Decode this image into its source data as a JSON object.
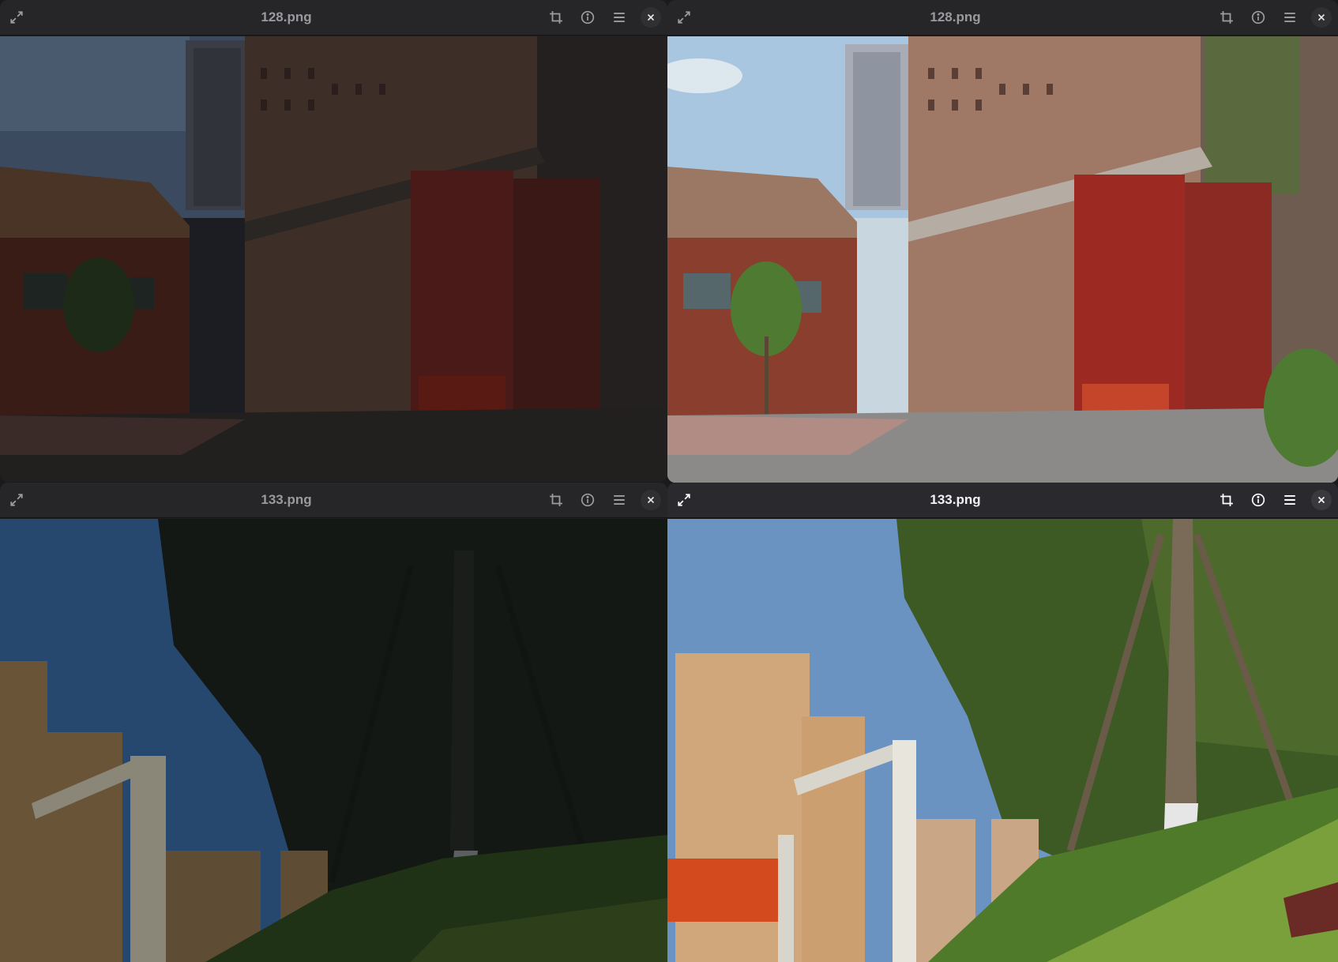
{
  "windows": [
    {
      "id": "top-left",
      "title": "128.png",
      "state": "inactive",
      "photo": "brick-building-dark"
    },
    {
      "id": "top-right",
      "title": "128.png",
      "state": "inactive",
      "photo": "brick-building-enhanced"
    },
    {
      "id": "bottom-left",
      "title": "133.png",
      "state": "inactive",
      "photo": "trees-apartments-dark"
    },
    {
      "id": "bottom-right",
      "title": "133.png",
      "state": "active",
      "photo": "trees-apartments-enhanced"
    }
  ],
  "icons": {
    "expand": "expand-icon",
    "crop": "crop-icon",
    "info": "info-icon",
    "menu": "menu-icon",
    "close": "close-icon"
  },
  "colors": {
    "headerbar": "#2a2a2e",
    "title_active": "#f2f2f2",
    "title_inactive": "#9a9a9e"
  }
}
